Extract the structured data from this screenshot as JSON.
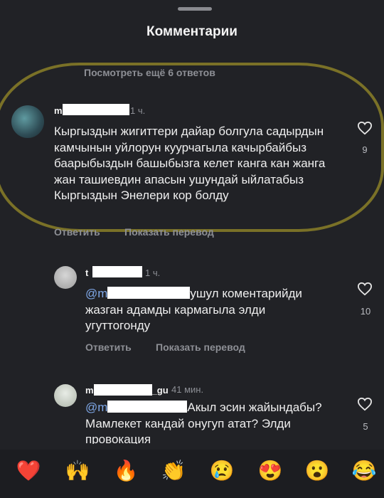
{
  "header": {
    "title": "Комментарии"
  },
  "thread": {
    "more_replies": "Посмотреть ещё 6 ответов"
  },
  "comments": [
    {
      "username_visible_start": "m",
      "username_visible_end": "",
      "time": "1 ч.",
      "text": "Кыргыздын жигиттери дайар болгула садырдын камчынын уйлорун куурчагыла качырбайбыз баарыбыздын башыбызга келет канга кан жанга жан ташиевдин апасын ушундай ыйлатабыз Кыргыздын Энелери кор болду",
      "likes": "9",
      "reply_label": "Ответить",
      "translate_label": "Показать перевод"
    },
    {
      "username_visible_start": "t",
      "username_visible_end": "",
      "time": "1 ч.",
      "mention_visible": "@m",
      "text_line1": "ушул коментарийди",
      "text_rest": "жазган адамды кармагыла элди угуттогонду",
      "likes": "10",
      "reply_label": "Ответить",
      "translate_label": "Показать перевод"
    },
    {
      "username_visible_start": "m",
      "username_visible_end": "_gu",
      "time": "41 мин.",
      "mention_visible": "@m",
      "text_line1": "Акыл эсин",
      "text_rest": "жайындабы? Мамлекет кандай онугуп атат? Элди провокация",
      "likes": "5"
    }
  ],
  "emoji_bar": {
    "items": [
      {
        "glyph": "❤️",
        "icon": "red-heart-icon"
      },
      {
        "glyph": "🙌",
        "icon": "raising-hands-icon"
      },
      {
        "glyph": "🔥",
        "icon": "fire-icon"
      },
      {
        "glyph": "👏",
        "icon": "clapping-hands-icon"
      },
      {
        "glyph": "😢",
        "icon": "crying-face-icon"
      },
      {
        "glyph": "😍",
        "icon": "heart-eyes-icon"
      },
      {
        "glyph": "😮",
        "icon": "surprised-face-icon"
      },
      {
        "glyph": "😂",
        "icon": "tears-of-joy-icon"
      }
    ]
  },
  "colors": {
    "background": "#212226",
    "highlight": "#c4b228",
    "mention": "#7fa8e8",
    "muted": "#8d8f95"
  }
}
